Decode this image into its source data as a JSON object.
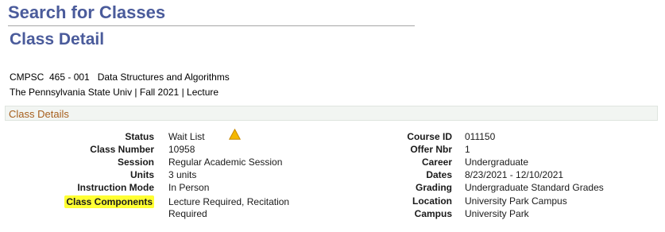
{
  "page": {
    "title": "Search for Classes",
    "subtitle": "Class Detail"
  },
  "class_info": {
    "line1": "CMPSC  465 - 001   Data Structures and Algorithms",
    "line2": "The Pennsylvania State Univ | Fall 2021 | Lecture"
  },
  "section": {
    "title": "Class Details"
  },
  "left_fields": {
    "status": {
      "label": "Status",
      "value": "Wait List"
    },
    "class_number": {
      "label": "Class Number",
      "value": "10958"
    },
    "session": {
      "label": "Session",
      "value": "Regular Academic Session"
    },
    "units": {
      "label": "Units",
      "value": "3 units"
    },
    "instruction_mode": {
      "label": "Instruction Mode",
      "value": "In Person"
    },
    "class_components": {
      "label": "Class Components",
      "value_line1": "Lecture Required, Recitation",
      "value_line2": "Required"
    }
  },
  "right_fields": {
    "course_id": {
      "label": "Course ID",
      "value": "011150"
    },
    "offer_nbr": {
      "label": "Offer Nbr",
      "value": "1"
    },
    "career": {
      "label": "Career",
      "value": "Undergraduate"
    },
    "dates": {
      "label": "Dates",
      "value": "8/23/2021 - 12/10/2021"
    },
    "grading": {
      "label": "Grading",
      "value": "Undergraduate Standard Grades"
    },
    "location": {
      "label": "Location",
      "value": "University Park Campus"
    },
    "campus": {
      "label": "Campus",
      "value": "University Park"
    }
  },
  "icons": {
    "status_icon": "warning-triangle-icon"
  },
  "colors": {
    "title": "#4a5b9b",
    "section_title": "#a65e1c",
    "highlight": "#ffff33",
    "warning": "#f5b800"
  }
}
